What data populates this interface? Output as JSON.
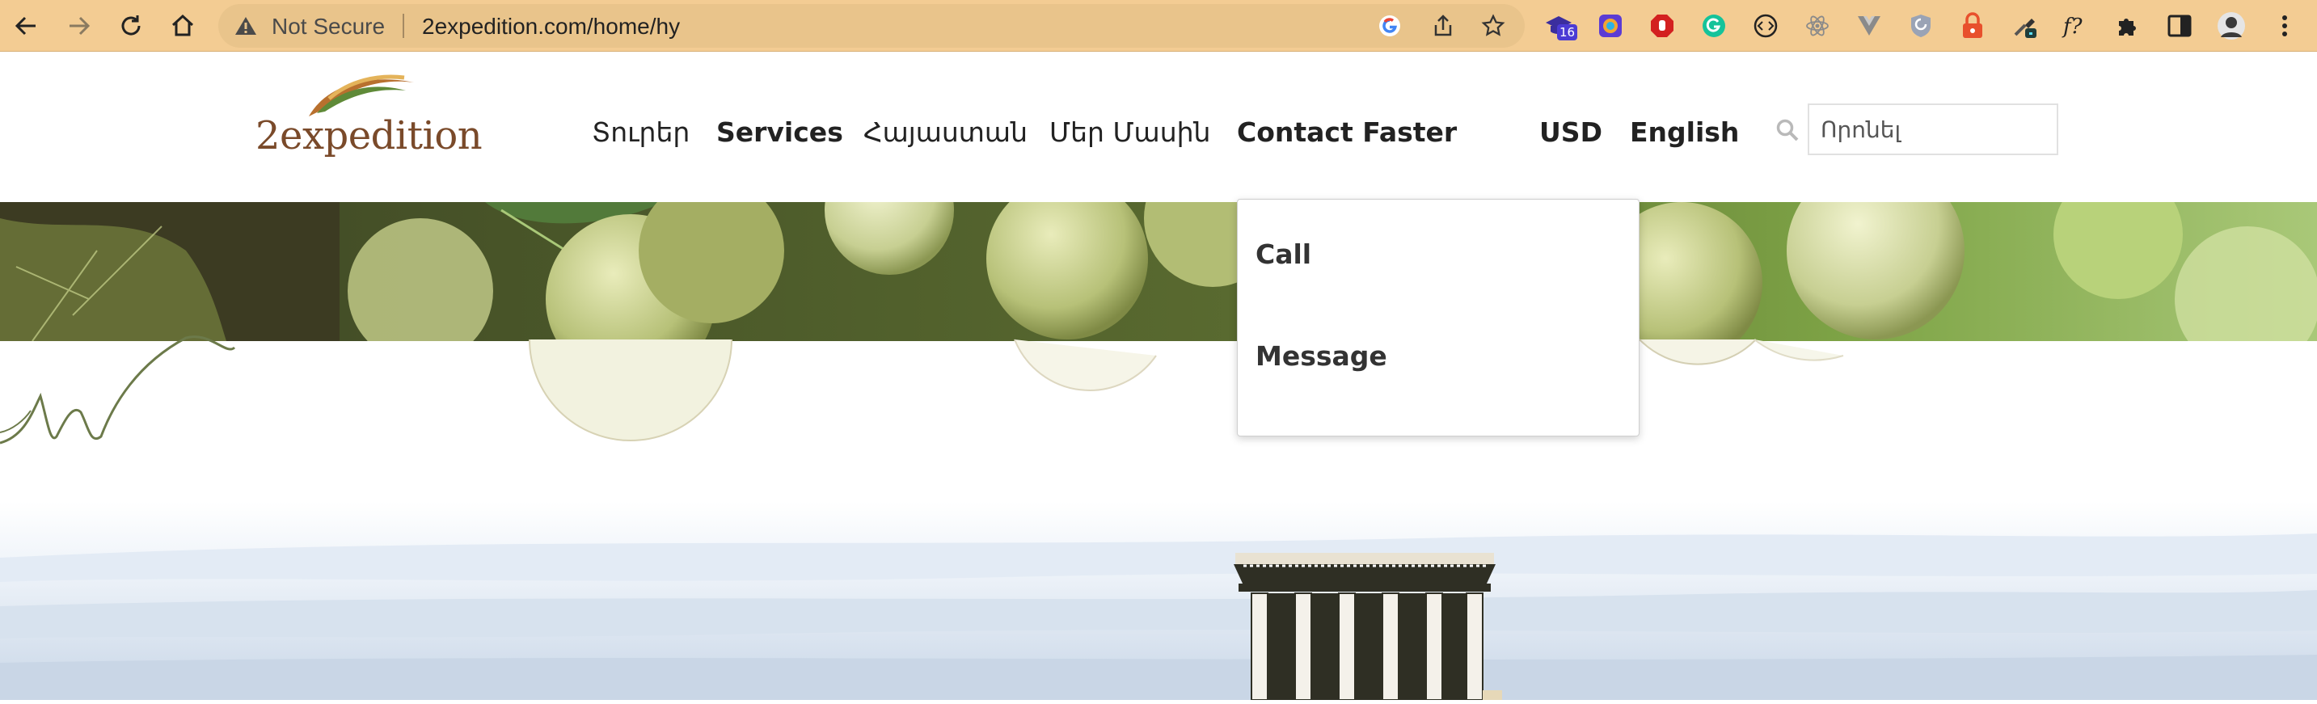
{
  "browser": {
    "security_label": "Not Secure",
    "url": "2expedition.com/home/hy",
    "extension_badge": "16"
  },
  "site": {
    "logo_text": "2expedition",
    "nav": [
      {
        "label": "Տուրեր"
      },
      {
        "label": "Services"
      },
      {
        "label": "Հայաստան"
      },
      {
        "label": "Մեր Մասին"
      },
      {
        "label": "Contact Faster"
      }
    ],
    "currency": "USD",
    "language": "English",
    "search": {
      "placeholder": "Որոնել"
    }
  },
  "dropdown": {
    "items": [
      {
        "label": "Call"
      },
      {
        "label": "Message"
      }
    ]
  },
  "colors": {
    "chrome_bg": "#f3cc93",
    "omnibox_bg": "#e9c48b",
    "grape_dark": "#3c3b22",
    "grape_light": "#c9d48e"
  }
}
